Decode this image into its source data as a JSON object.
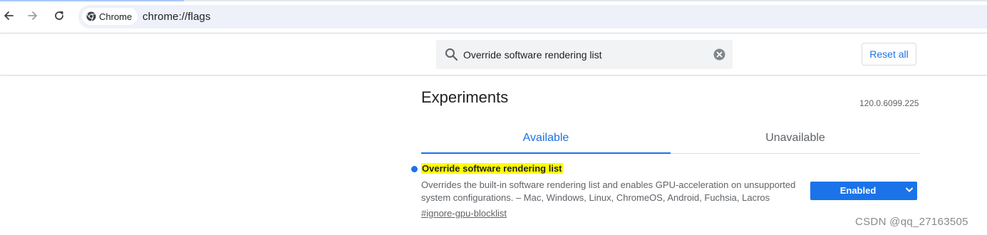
{
  "browser": {
    "chip_label": "Chrome",
    "url": "chrome://flags"
  },
  "header": {
    "search_value": "Override software rendering list",
    "reset_label": "Reset all"
  },
  "main": {
    "title": "Experiments",
    "version": "120.0.6099.225",
    "tabs": [
      {
        "label": "Available",
        "selected": true
      },
      {
        "label": "Unavailable",
        "selected": false
      }
    ]
  },
  "flag": {
    "name": "Override software rendering list",
    "description": "Overrides the built-in software rendering list and enables GPU-acceleration on unsupported system configurations. – Mac, Windows, Linux, ChromeOS, Android, Fuchsia, Lacros",
    "link": "#ignore-gpu-blocklist",
    "state": "Enabled"
  },
  "watermark": "CSDN @qq_27163505",
  "colors": {
    "accent": "#1a73e8",
    "highlight": "#ffff00",
    "omnibox": "#eef1f9"
  },
  "icons": [
    "back-arrow-icon",
    "forward-arrow-icon",
    "reload-icon",
    "chrome-logo-icon",
    "search-icon",
    "clear-icon",
    "chevron-down-icon"
  ]
}
